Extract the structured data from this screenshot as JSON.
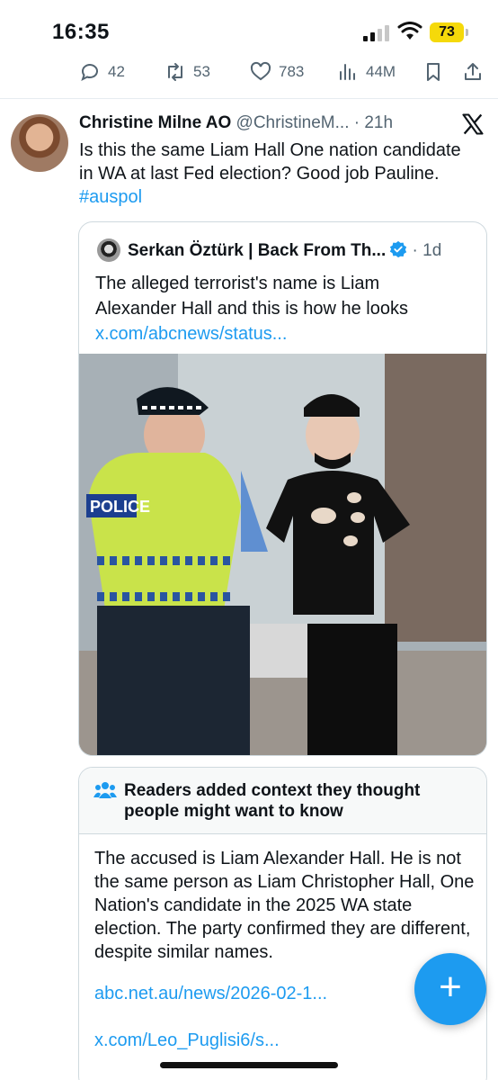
{
  "status_bar": {
    "time": "16:35",
    "battery": "73",
    "colors": {
      "battery": "#f5d90a"
    }
  },
  "action_bar": {
    "replies": "42",
    "reposts": "53",
    "likes": "783",
    "views": "44M",
    "icons": [
      "reply-icon",
      "repost-icon",
      "like-icon",
      "views-icon",
      "bookmark-icon",
      "share-icon"
    ]
  },
  "tweet": {
    "author_name": "Christine Milne AO",
    "handle": "@ChristineM...",
    "separator": " · ",
    "time": "21h",
    "text_line1": "Is this the same Liam Hall One nation candidate",
    "text_line2": "in WA at last Fed election? Good job Pauline.",
    "hashtag": "#auspol"
  },
  "quote": {
    "author_name": "Serkan Öztürk | Back From Th...",
    "separator": " · ",
    "time": "1d",
    "text_line1": "The alleged terrorist's name is Liam",
    "text_line2": "Alexander Hall and this is how he looks",
    "link": "x.com/abcnews/status...",
    "photo_text": "POLICE"
  },
  "community_note": {
    "title": "Readers added context they thought people might want to know",
    "body": "The accused is Liam Alexander Hall. He is not the same person as Liam Christopher Hall, One Nation's candidate in the 2025 WA state election. The party confirmed they are different, despite similar names.",
    "link1": "abc.net.au/news/2026-02-1...",
    "link2": "x.com/Leo_Puglisi6/s..."
  },
  "fab": {
    "label": "+"
  },
  "colors": {
    "accent": "#1d9bf0",
    "text": "#0f1419",
    "muted": "#536471"
  }
}
